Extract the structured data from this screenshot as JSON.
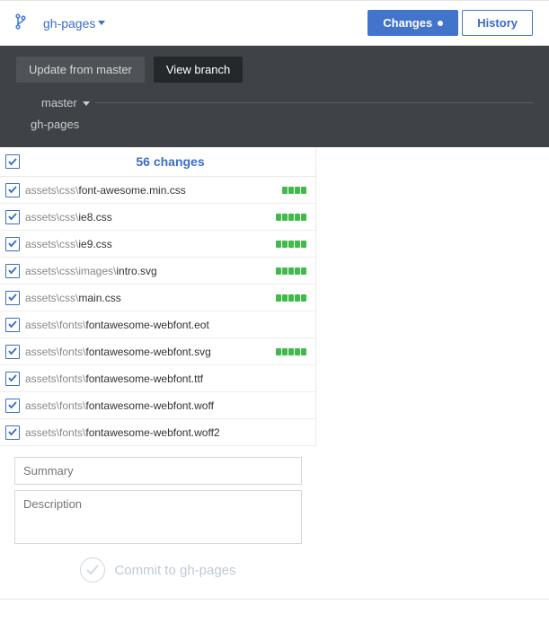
{
  "topbar": {
    "branch_label": "gh-pages",
    "tabs": {
      "changes": "Changes",
      "history": "History"
    }
  },
  "darkbar": {
    "update_btn": "Update from master",
    "view_btn": "View branch",
    "branches": {
      "master": "master",
      "gh_pages": "gh-pages"
    }
  },
  "changes": {
    "header": "56 changes"
  },
  "files": [
    {
      "dir": "assets\\css\\",
      "name": "font-awesome.min.css",
      "adds": 4
    },
    {
      "dir": "assets\\css\\",
      "name": "ie8.css",
      "adds": 5
    },
    {
      "dir": "assets\\css\\",
      "name": "ie9.css",
      "adds": 5
    },
    {
      "dir": "assets\\css\\images\\",
      "name": "intro.svg",
      "adds": 5
    },
    {
      "dir": "assets\\css\\",
      "name": "main.css",
      "adds": 5
    },
    {
      "dir": "assets\\fonts\\",
      "name": "fontawesome-webfont.eot",
      "adds": 0
    },
    {
      "dir": "assets\\fonts\\",
      "name": "fontawesome-webfont.svg",
      "adds": 5
    },
    {
      "dir": "assets\\fonts\\",
      "name": "fontawesome-webfont.ttf",
      "adds": 0
    },
    {
      "dir": "assets\\fonts\\",
      "name": "fontawesome-webfont.woff",
      "adds": 0
    },
    {
      "dir": "assets\\fonts\\",
      "name": "fontawesome-webfont.woff2",
      "adds": 0
    }
  ],
  "commit": {
    "summary_placeholder": "Summary",
    "description_placeholder": "Description",
    "button_label": "Commit to gh-pages"
  }
}
